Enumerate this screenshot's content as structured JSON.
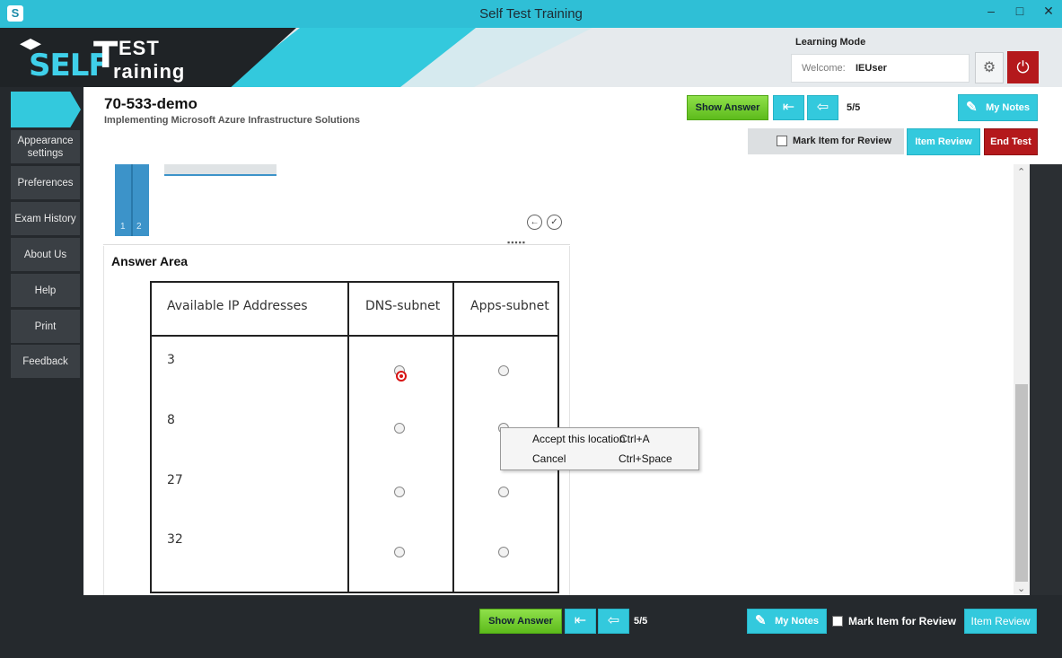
{
  "window": {
    "title": "Self Test Training",
    "minimize": "–",
    "maximize": "□",
    "close": "✕"
  },
  "logo": {
    "self": "SELF",
    "t": "T",
    "est": "EST",
    "raining": "raining"
  },
  "header": {
    "mode": "Learning Mode",
    "welcome_label": "Welcome:",
    "username": "IEUser"
  },
  "sidebar": {
    "items": [
      {
        "label": "Appearance settings"
      },
      {
        "label": "Preferences"
      },
      {
        "label": "Exam History"
      },
      {
        "label": "About Us"
      },
      {
        "label": "Help"
      },
      {
        "label": "Print"
      },
      {
        "label": "Feedback"
      }
    ]
  },
  "question": {
    "code": "70-533-demo",
    "subtitle": "Implementing Microsoft Azure Infrastructure Solutions"
  },
  "toolbar": {
    "show_answer": "Show Answer",
    "counter": "5/5",
    "my_notes": "My Notes",
    "mark_review": "Mark Item for Review",
    "item_review": "Item Review",
    "end_test": "End Test"
  },
  "thumbnails": {
    "numbers": [
      "1",
      "2"
    ]
  },
  "answer_area": {
    "title": "Answer Area",
    "headers": [
      "Available IP Addresses",
      "DNS-subnet",
      "Apps-subnet"
    ],
    "rows": [
      {
        "value": "3",
        "dns_selected": true,
        "apps_selected": false
      },
      {
        "value": "8",
        "dns_selected": false,
        "apps_selected": false
      },
      {
        "value": "27",
        "dns_selected": false,
        "apps_selected": false
      },
      {
        "value": "32",
        "dns_selected": false,
        "apps_selected": false
      }
    ]
  },
  "context_menu": {
    "items": [
      {
        "label": "Accept this location",
        "shortcut": "Ctrl+A"
      },
      {
        "label": "Cancel",
        "shortcut": "Ctrl+Space"
      }
    ]
  },
  "bottom": {
    "show_answer": "Show Answer",
    "counter": "5/5",
    "my_notes": "My Notes",
    "mark_review": "Mark Item for Review",
    "item_review": "Item Review"
  },
  "colors": {
    "accent": "#33c9dd",
    "green": "#6cc72a",
    "danger": "#b4191c",
    "sidebar": "#25292d"
  }
}
